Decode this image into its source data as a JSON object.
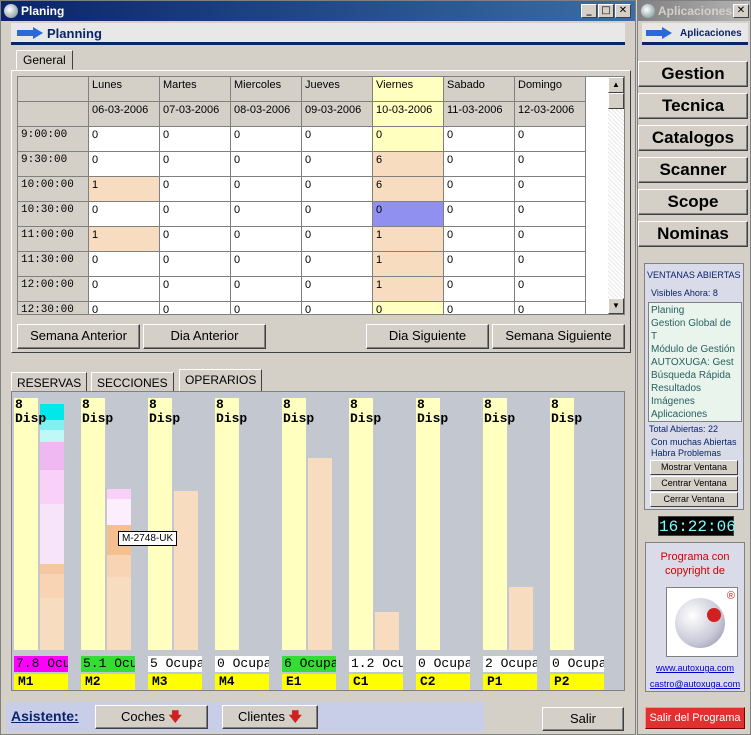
{
  "main_window": {
    "title": "Planing",
    "header": "Planning"
  },
  "right_window": {
    "title": "Aplicaciones",
    "header": "Aplicaciones"
  },
  "tabs": {
    "general": "General"
  },
  "grid": {
    "days": [
      "Lunes",
      "Martes",
      "Miercoles",
      "Jueves",
      "Viernes",
      "Sabado",
      "Domingo"
    ],
    "dates": [
      "06-03-2006",
      "07-03-2006",
      "08-03-2006",
      "09-03-2006",
      "10-03-2006",
      "11-03-2006",
      "12-03-2006"
    ],
    "rows": [
      {
        "time": "9:00:00",
        "values": [
          "0",
          "0",
          "0",
          "0",
          "0",
          "0",
          "0"
        ]
      },
      {
        "time": "9:30:00",
        "values": [
          "0",
          "0",
          "0",
          "0",
          "6",
          "0",
          "0"
        ]
      },
      {
        "time": "10:00:00",
        "values": [
          "1",
          "0",
          "0",
          "0",
          "6",
          "0",
          "0"
        ]
      },
      {
        "time": "10:30:00",
        "values": [
          "0",
          "0",
          "0",
          "0",
          "0",
          "0",
          "0"
        ]
      },
      {
        "time": "11:00:00",
        "values": [
          "1",
          "0",
          "0",
          "0",
          "1",
          "0",
          "0"
        ]
      },
      {
        "time": "11:30:00",
        "values": [
          "0",
          "0",
          "0",
          "0",
          "1",
          "0",
          "0"
        ]
      },
      {
        "time": "12:00:00",
        "values": [
          "0",
          "0",
          "0",
          "0",
          "1",
          "0",
          "0"
        ]
      },
      {
        "time": "12:30:00",
        "values": [
          "0",
          "0",
          "0",
          "0",
          "0",
          "0",
          "0"
        ]
      }
    ]
  },
  "nav": {
    "prev_week": "Semana Anterior",
    "prev_day": "Dia Anterior",
    "next_day": "Dia Siguiente",
    "next_week": "Semana Siguiente"
  },
  "panel_tabs": [
    "RESERVAS",
    "SECCIONES",
    "OPERARIOS"
  ],
  "operarios": [
    {
      "code": "M1",
      "disp": "8",
      "disp_label": "Disp",
      "ocup": "7.8 Ocu",
      "ocup_fill": 0.975,
      "ocup_color": "#ff00ff"
    },
    {
      "code": "M2",
      "disp": "8",
      "disp_label": "Disp",
      "ocup": "5.1 Ocu",
      "ocup_fill": 0.64,
      "ocup_color": "#33dd33"
    },
    {
      "code": "M3",
      "disp": "8",
      "disp_label": "Disp",
      "ocup": "5 Ocupa",
      "ocup_fill": 0.63,
      "ocup_color": "#ffffff"
    },
    {
      "code": "M4",
      "disp": "8",
      "disp_label": "Disp",
      "ocup": "0 Ocupa",
      "ocup_fill": 0,
      "ocup_color": "#ffffff"
    },
    {
      "code": "E1",
      "disp": "8",
      "disp_label": "Disp",
      "ocup": "6 Ocupa",
      "ocup_fill": 0.76,
      "ocup_color": "#33dd33"
    },
    {
      "code": "C1",
      "disp": "8",
      "disp_label": "Disp",
      "ocup": "1.2 Ocu",
      "ocup_fill": 0.15,
      "ocup_color": "#ffffff"
    },
    {
      "code": "C2",
      "disp": "8",
      "disp_label": "Disp",
      "ocup": "0 Ocupa",
      "ocup_fill": 0,
      "ocup_color": "#ffffff"
    },
    {
      "code": "P1",
      "disp": "8",
      "disp_label": "Disp",
      "ocup": "2 Ocupa",
      "ocup_fill": 0.25,
      "ocup_color": "#ffffff"
    },
    {
      "code": "P2",
      "disp": "8",
      "disp_label": "Disp",
      "ocup": "0 Ocupa",
      "ocup_fill": 0,
      "ocup_color": "#ffffff"
    }
  ],
  "tooltip": "M-2748-UK",
  "bottom": {
    "asistente": "Asistente:",
    "coches": "Coches",
    "clientes": "Clientes",
    "salir": "Salir"
  },
  "menu": [
    "Gestion",
    "Tecnica",
    "Catalogos",
    "Scanner",
    "Scope",
    "Nominas"
  ],
  "ventanas": {
    "title": "VENTANAS ABIERTAS",
    "visibles": "Visibles Ahora: 8",
    "items": [
      "Planing",
      "Gestion Global de T",
      "Módulo de Gestión",
      "AUTOXUGA: Gest",
      "Búsqueda Rápida",
      "Resultados",
      "Imágenes",
      "Aplicaciones"
    ],
    "total": "Total Abiertas: 22",
    "warn1": "Con muchas Abiertas",
    "warn2": "Habra Problemas",
    "mostrar": "Mostrar Ventana",
    "centrar": "Centrar Ventana",
    "cerrar": "Cerrar Ventana"
  },
  "clock": "16:22:06",
  "copyright": {
    "line1": "Programa con",
    "line2": "copyright de",
    "web": "www.autoxuga.com",
    "mail": "castro@autoxuga.com"
  },
  "exit_program": "Salir del Programa"
}
